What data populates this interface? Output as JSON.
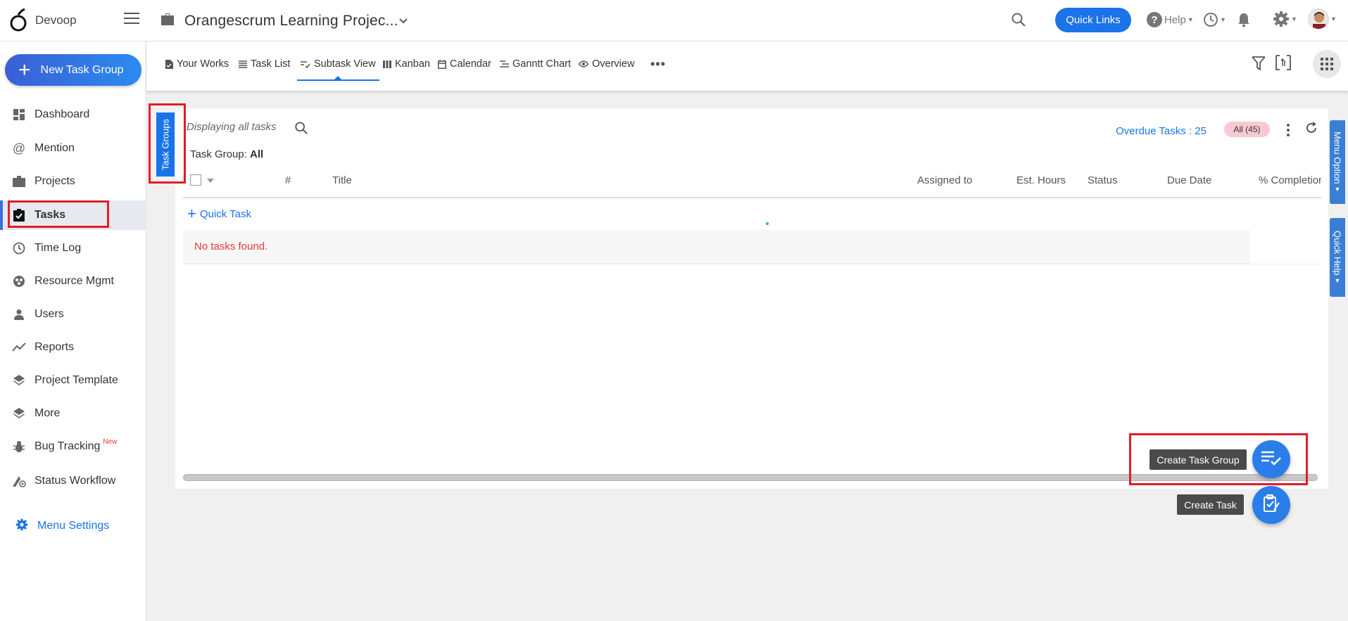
{
  "app": {
    "brand": "Devoop",
    "project_title": "Orangescrum Learning Projec..."
  },
  "topbar": {
    "quick_links": "Quick Links",
    "help": "Help"
  },
  "sidebar": {
    "new_button": "New Task Group",
    "items": [
      {
        "label": "Dashboard",
        "icon": "dashboard-icon"
      },
      {
        "label": "Mention",
        "icon": "at-icon"
      },
      {
        "label": "Projects",
        "icon": "briefcase-icon"
      },
      {
        "label": "Tasks",
        "icon": "task-check-icon",
        "active": true
      },
      {
        "label": "Time Log",
        "icon": "clock-icon"
      },
      {
        "label": "Resource Mgmt",
        "icon": "resource-icon"
      },
      {
        "label": "Users",
        "icon": "user-icon"
      },
      {
        "label": "Reports",
        "icon": "trend-icon"
      },
      {
        "label": "Project Template",
        "icon": "layers-icon"
      },
      {
        "label": "More",
        "icon": "layers-icon"
      },
      {
        "label": "Bug Tracking",
        "icon": "bug-icon",
        "badge": "New"
      },
      {
        "label": "Status Workflow",
        "icon": "workflow-icon"
      }
    ],
    "menu_settings": "Menu Settings"
  },
  "tabs": [
    {
      "label": "Your Works",
      "icon": "doc-icon"
    },
    {
      "label": "Task List",
      "icon": "list-icon"
    },
    {
      "label": "Subtask View",
      "icon": "subtask-icon",
      "active": true
    },
    {
      "label": "Kanban",
      "icon": "kanban-icon"
    },
    {
      "label": "Calendar",
      "icon": "calendar-icon"
    },
    {
      "label": "Ganntt Chart",
      "icon": "gantt-icon"
    },
    {
      "label": "Overview",
      "icon": "eye-icon"
    }
  ],
  "panel": {
    "task_groups_tab": "Task Groups",
    "displaying": "Displaying all tasks",
    "task_group_label": "Task Group:",
    "task_group_value": "All",
    "overdue": "Overdue Tasks : 25",
    "all_badge": "All (45)",
    "columns": [
      "#",
      "Title",
      "Assigned to",
      "Est. Hours",
      "Status",
      "Due Date",
      "% Completion"
    ],
    "quick_task": "Quick Task",
    "empty": "No tasks found."
  },
  "side_tabs": {
    "menu_option": "Menu Option",
    "quick_help": "Quick Help"
  },
  "fabs": {
    "create_task_group": "Create Task Group",
    "create_task": "Create Task"
  },
  "colors": {
    "accent": "#1a73e8",
    "highlight_box": "#e11d2a",
    "overdue_badge": "#f7c9d3"
  }
}
